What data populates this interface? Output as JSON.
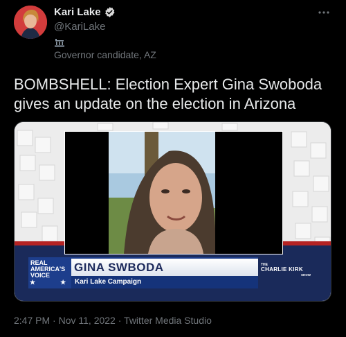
{
  "author": {
    "name": "Kari Lake",
    "handle": "@KariLake",
    "affiliation": "Governor candidate, AZ",
    "avatar": "avatar-photo",
    "verified_icon": "verified-badge-icon",
    "label_icon": "government-building-icon"
  },
  "menu": {
    "icon": "more-options-icon"
  },
  "tweet": {
    "text_lines": [
      "BOMBSHELL: Election Expert Gina Swoboda",
      "gives an update on the election in Arizona"
    ]
  },
  "media": {
    "type": "video",
    "lower_third": {
      "left_brand_lines": [
        "REAL",
        "AMERICA'S",
        "VOICE"
      ],
      "name": "GINA SWBODA",
      "subtitle": "Kari Lake Campaign",
      "right_brand_top": "THE",
      "right_brand_main": "CHARLIE KIRK",
      "right_brand_bottom": "SHOW"
    },
    "colors": {
      "navy": "#1d3e8c",
      "red": "#c0392b"
    }
  },
  "footer": {
    "time": "2:47 PM",
    "date": "Nov 11, 2022",
    "source": "Twitter Media Studio",
    "separator": "·"
  }
}
